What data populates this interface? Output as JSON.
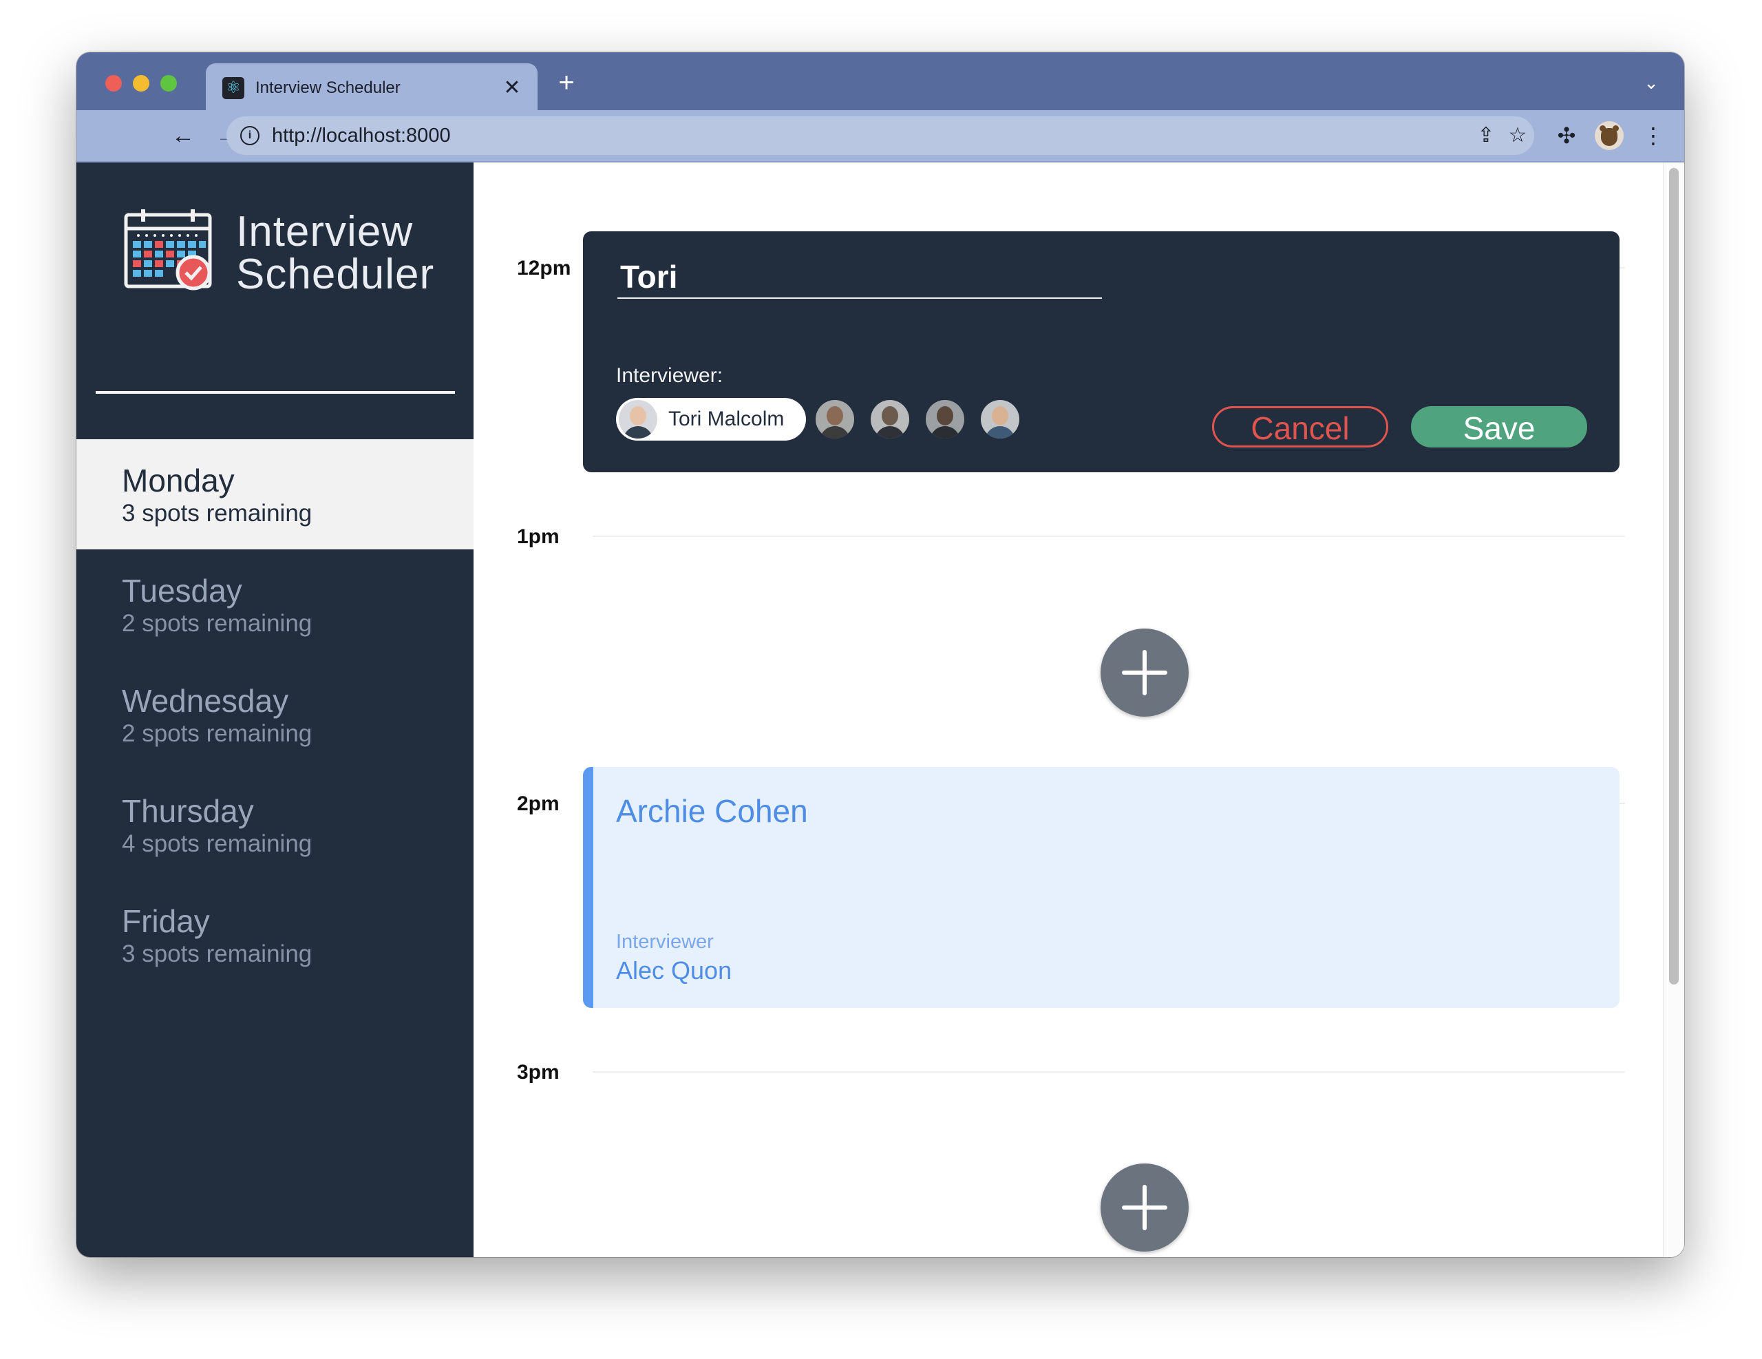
{
  "browser": {
    "tab_title": "Interview Scheduler",
    "url": "http://localhost:8000"
  },
  "sidebar": {
    "brand_line1": "Interview",
    "brand_line2": "Scheduler",
    "days": [
      {
        "name": "Monday",
        "spots": "3 spots remaining",
        "selected": true
      },
      {
        "name": "Tuesday",
        "spots": "2 spots remaining",
        "selected": false
      },
      {
        "name": "Wednesday",
        "spots": "2 spots remaining",
        "selected": false
      },
      {
        "name": "Thursday",
        "spots": "4 spots remaining",
        "selected": false
      },
      {
        "name": "Friday",
        "spots": "3 spots remaining",
        "selected": false
      }
    ]
  },
  "schedule": {
    "times": [
      "12pm",
      "1pm",
      "2pm",
      "3pm"
    ],
    "form": {
      "student_value": "Tori",
      "interviewer_label": "Interviewer:",
      "selected_interviewer": "Tori Malcolm",
      "cancel_label": "Cancel",
      "save_label": "Save"
    },
    "booked": {
      "student": "Archie Cohen",
      "interviewer_label": "Interviewer",
      "interviewer": "Alec Quon"
    }
  },
  "colors": {
    "sidebar_bg": "#222d3e",
    "cancel": "#e0544e",
    "save": "#4fa37e",
    "booked_accent": "#5c99f0"
  }
}
